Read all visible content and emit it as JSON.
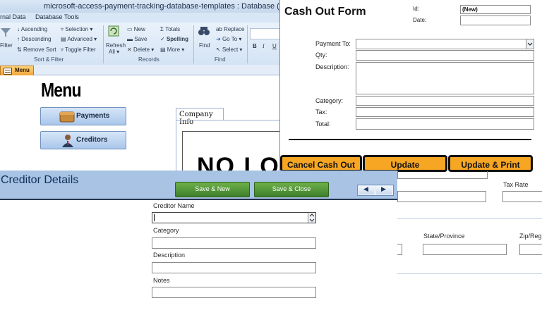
{
  "window": {
    "title": "microsoft-access-payment-tracking-database-templates : Database (Acc",
    "tabs": [
      "rnal Data",
      "Database Tools"
    ]
  },
  "ribbon": {
    "sort_filter": {
      "filter": "Filter",
      "ascending": "Ascending",
      "descending": "Descending",
      "remove_sort": "Remove Sort",
      "selection": "Selection",
      "advanced": "Advanced",
      "toggle_filter": "Toggle Filter",
      "group": "Sort & Filter"
    },
    "records": {
      "refresh": "Refresh",
      "refresh_all": "All",
      "new": "New",
      "save": "Save",
      "delete": "Delete",
      "totals": "Totals",
      "spelling": "Spelling",
      "more": "More",
      "group": "Records"
    },
    "find": {
      "find": "Find",
      "replace": "Replace",
      "goto": "Go To",
      "select": "Select",
      "group": "Find"
    }
  },
  "document_tab": "Menu",
  "menu": {
    "title": "Menu",
    "payments": "Payments",
    "creditors": "Creditors",
    "company_info_tab": "Company Info",
    "logo_text": "NO LOG"
  },
  "cash_out": {
    "title": "Cash Out Form",
    "id_label": "Id:",
    "id_value": "(New)",
    "date_label": "Date:",
    "payment_to_label": "Payment To:",
    "qty_label": "Qty:",
    "description_label": "Description:",
    "category_label": "Category:",
    "tax_label": "Tax:",
    "total_label": "Total:",
    "cancel_button": "Cancel Cash Out",
    "update_button": "Update",
    "update_print_button": "Update & Print"
  },
  "background_form": {
    "tax_rate": "Tax Rate",
    "state_province": "State/Province",
    "zip": "Zip/Reg"
  },
  "creditor": {
    "title": "Creditor Details",
    "save_new": "Save & New",
    "save_close": "Save & Close",
    "prev_icon": "◀",
    "next_icon": "▶",
    "creditor_name_label": "Creditor Name",
    "category_label": "Category",
    "description_label": "Description",
    "notes_label": "Notes"
  },
  "colors": {
    "orange_button": "#f6a623",
    "green_button": "#3c7f2a",
    "header_blue": "#a8c3e4"
  }
}
